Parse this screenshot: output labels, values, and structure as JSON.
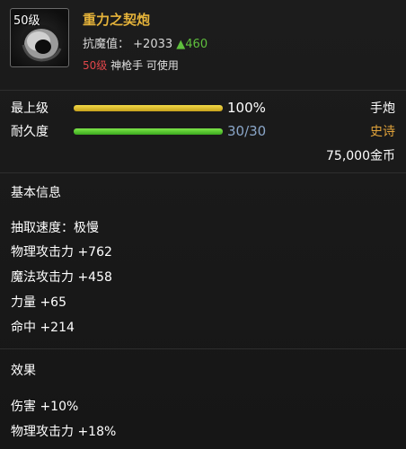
{
  "item": {
    "icon_level": "50级",
    "name": "重力之契炮",
    "resist_label": "抗魔值：",
    "resist_value": "+2033",
    "resist_up": "▲460",
    "req_level": "50级",
    "req_text": " 神枪手 可使用"
  },
  "bars": {
    "max_level": {
      "label": "最上级",
      "value": "100%",
      "percent": 100
    },
    "durability": {
      "label": "耐久度",
      "value": "30/30",
      "percent": 100
    }
  },
  "side": {
    "type": "手炮",
    "rarity": "史诗",
    "price": "75,000金币"
  },
  "basic": {
    "title": "基本信息",
    "attrs": [
      "抽取速度：极慢",
      "物理攻击力 +762",
      "魔法攻击力 +458",
      "力量 +65",
      "命中 +214"
    ]
  },
  "effects": {
    "title": "效果",
    "attrs": [
      "伤害 +10%",
      "物理攻击力 +18%"
    ]
  },
  "colors": {
    "title": "#e6b43a",
    "rarity": "#e0a23a",
    "bar_max": "#e2c237",
    "bar_durability": "#5bd03a",
    "value_max": "#ffffff",
    "value_durability": "#8aa6c8",
    "required_level": "#e0464a",
    "resist_up": "#5fbf3d"
  },
  "icons": {
    "item": "hand-cannon-icon"
  }
}
